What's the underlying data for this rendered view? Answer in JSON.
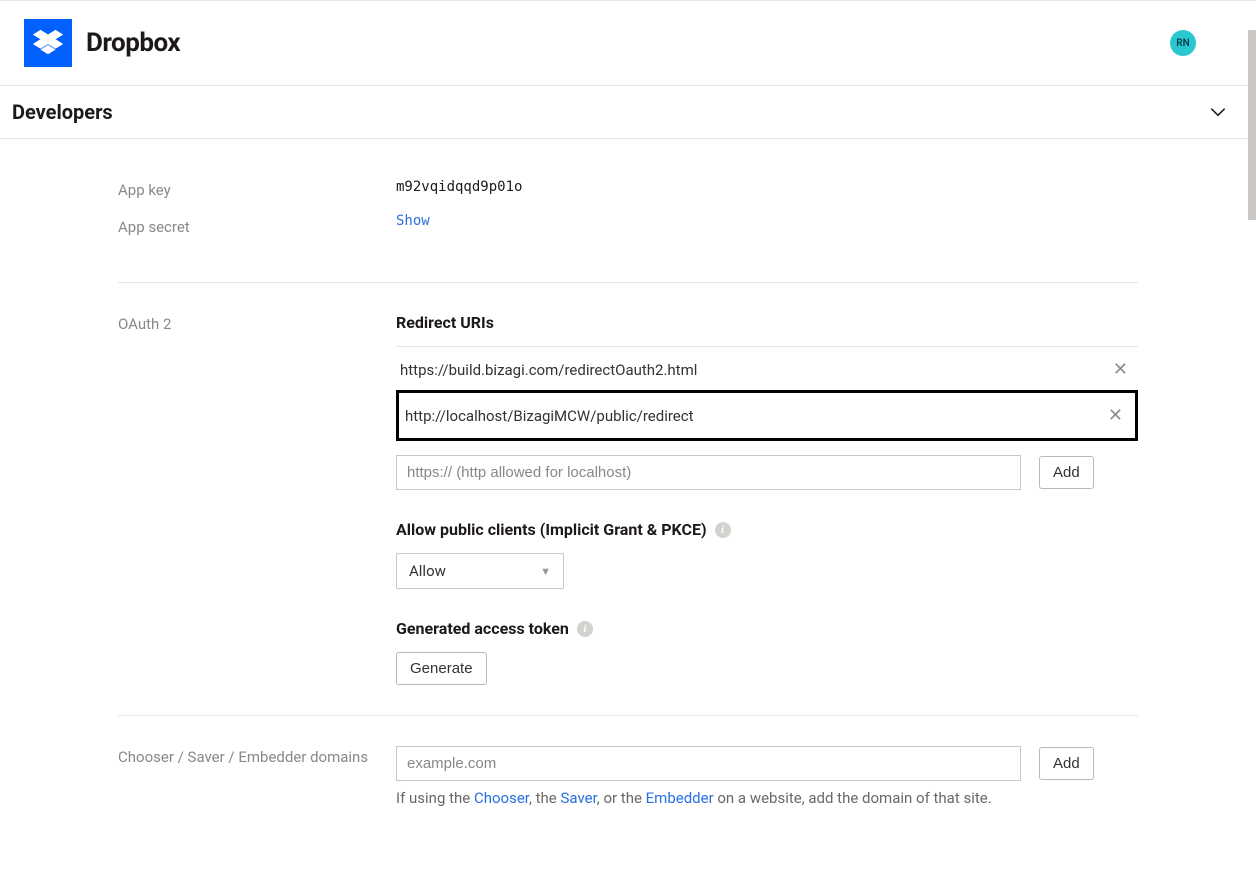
{
  "header": {
    "brand": "Dropbox",
    "avatar_initials": "RN"
  },
  "subheader": {
    "title": "Developers"
  },
  "credentials": {
    "appkey_label": "App key",
    "appkey_value": "m92vqidqqd9p01o",
    "appsecret_label": "App secret",
    "appsecret_action": "Show"
  },
  "oauth": {
    "section_label": "OAuth 2",
    "redirect_title": "Redirect URIs",
    "uris": [
      "https://build.bizagi.com/redirectOauth2.html",
      "http://localhost/BizagiMCW/public/redirect"
    ],
    "uri_input_placeholder": "https:// (http allowed for localhost)",
    "add_label": "Add",
    "public_clients_title": "Allow public clients (Implicit Grant & PKCE)",
    "public_clients_value": "Allow",
    "generated_token_title": "Generated access token",
    "generate_label": "Generate"
  },
  "domains": {
    "section_label": "Chooser / Saver / Embedder domains",
    "input_placeholder": "example.com",
    "add_label": "Add",
    "hint_pre": "If using the ",
    "hint_chooser": "Chooser",
    "hint_mid1": ", the ",
    "hint_saver": "Saver",
    "hint_mid2": ", or the ",
    "hint_embedder": "Embedder",
    "hint_post": " on a website, add the domain of that site."
  }
}
